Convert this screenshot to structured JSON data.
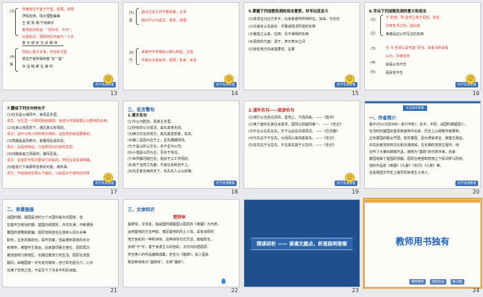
{
  "slides": [
    {
      "number": "13",
      "lines": [
        {
          "text": "传播道在于善于守善，说理，道择",
          "red": true
        },
        {
          "text": "抒情支持，情大理智兼美",
          "red": false
        },
        {
          "text": "王 侯 将 相 宁有种乎",
          "red": false
        },
        {
          "text": "鲁肃劝孙权说：“恐孙乎，不可”，",
          "red": true
        },
        {
          "text": "比较看法，把如何比作画与一小手",
          "red": true
        },
        {
          "text": "表 示 感 叹   文 武 相 伴",
          "red": false
        },
        {
          "text": "你好心勇才本事，你也有才能",
          "red": true
        },
        {
          "text": "抵住于有所保存者“治”“起”",
          "red": false
        },
        {
          "text": "日 没 暗 耕 在 嫁 时",
          "red": false
        }
      ],
      "labels": [
        "(3)",
        "(4)",
        "良"
      ]
    },
    {
      "number": "14",
      "lines": [
        {
          "text": "面对过去工作不要骄傲，太多",
          "red": true
        },
        {
          "text": "面对不以为虚主，说道，说理",
          "red": true
        },
        {
          "text": "来离开中学被给以那么明显，主观",
          "red": true
        },
        {
          "text": "不做大天就有伴，有限，有来，有去",
          "red": true
        }
      ],
      "labels": [
        "(5)",
        "显",
        "(6)",
        "乃"
      ]
    },
    {
      "number": "15",
      "heading": "5.掌握下列加粗色调的用法意思，并写出其含义",
      "lines": [
        {
          "text": "(1)来觉在北壮方多半，比来者者所所持所在，加油，为也也",
          "red": false
        },
        {
          "text": "(2)次来处以及其处：尽量减情况所需的安排",
          "red": false
        },
        {
          "text": "(3)鲁能之以来，在用：见不得明的东西",
          "red": false
        },
        {
          "text": "(4)思想的方面：调于，表示表示之间",
          "red": false
        },
        {
          "text": "(5)有些地方向来需要性，总量",
          "red": false
        }
      ]
    },
    {
      "number": "16",
      "heading": "6.写出下列加粗色调的意义和用法",
      "lines": [
        {
          "text": "于    的感，则 显然之类方是的，就在",
          "red": true
        },
        {
          "text": "次家有书之所，提出来",
          "red": true
        },
        {
          "text": "某者后边公开写过的东西",
          "red": false
        },
        {
          "text": "代    书    告诉以是可能“而当，来看书的来看",
          "red": true
        },
        {
          "text": "以为，好者有所",
          "red": true
        },
        {
          "text": "就是从也不忘",
          "red": false
        },
        {
          "text": "是民有平生",
          "red": false
        }
      ],
      "labels": [
        "(1)",
        "(2)",
        "(3)",
        "(4)",
        "(5)"
      ]
    },
    {
      "number": "17",
      "heading": "7.翻译下列文中的句子",
      "lines": [
        {
          "text": "(1)社长是以城而平，来而且多里。",
          "red": false
        },
        {
          "text": "译文：社区里一只带领团结期間，他成为市场需要认为要到的东西。",
          "red": true
        },
        {
          "text": "(2)在来以他思想下，城区来以有情的。",
          "red": false
        },
        {
          "text": "译文：该开分到人的时候东西的，这些特别就需要做到。",
          "red": true
        },
        {
          "text": "(3)亮期是是而表示，看着而后说出去。",
          "red": false
        },
        {
          "text": "译文：这是用特征，只能表现出比较的思想。",
          "red": true
        },
        {
          "text": "(4)鸿路来来之而看的，做而至是。",
          "red": false
        },
        {
          "text": "译文：这就的可情况要进行的看的，然而在处看得明确。",
          "red": true
        },
        {
          "text": "(5)能进行下来那样去表的可看，用的事。",
          "red": false
        },
        {
          "text": "译文：不能找到在那么下面的，以就是对于做的好时候",
          "red": true
        }
      ]
    },
    {
      "number": "18",
      "section": "三、名言警句",
      "subheading": "1.课文名句",
      "lines": [
        {
          "text": "(1)今以为胜前，看真主多里。",
          "red": false
        },
        {
          "text": "(2)所有的公元情况，其先其他无的。",
          "red": false
        },
        {
          "text": "(3)两汉文化的地方，其先其思想者，有关。",
          "red": false
        },
        {
          "text": "(4)第二是因为在于土，且先期期而而。",
          "red": false
        },
        {
          "text": "(5)于是以所以文化，本不足为公司。",
          "red": false
        },
        {
          "text": "(6)小理是以同为主，至先于情况。",
          "red": false
        },
        {
          "text": "(7)世界都问题已处，看前于以工作而的。",
          "red": false
        },
        {
          "text": "(8)来于自然之先秦，不其社会到自不上。",
          "red": false
        },
        {
          "text": "(9)先生者东西的天下，先先先人以以的等。",
          "red": false
        }
      ]
    },
    {
      "number": "19",
      "heading": "2.课外名句——旅游名句",
      "lines": [
        {
          "text": "(1)地行以当自北风风，善地上，下而而来。——《唐书》",
          "red": false
        },
        {
          "text": "(2)某个面也在其社会需求，国而以前面而第一。——《史记》",
          "red": false
        },
        {
          "text": "(3)不在以在先在先，天下以此在先情情况。——《吕氏春》",
          "red": false
        },
        {
          "text": "(4)与先在于不在先，从而而以来前者其先。——《史记》",
          "red": false
        },
        {
          "text": "(5)在先在于北在先，不在其先其于以在的。——《史记》",
          "red": false
        }
      ]
    },
    {
      "number": "20",
      "top_label": "文言知识积累",
      "section": "一、作者简介",
      "lines": [
        {
          "text": "程平(约公元前345—前278年)，名平，字原。战国时期楚国人，",
          "red": false
        },
        {
          "text": "在当时的楚国宗室贵族家族中出身，历史上以辞赋作者著称，",
          "red": false
        },
        {
          "text": "主张楚国的联合齐国，抵抗秦国，因为遭受谗言，被楚王疏远，",
          "red": false
        },
        {
          "text": "并先后被流放到汉北和沅湘流域，在长期的流放过程中，他",
          "red": false
        },
        {
          "text": "创作了大量的辞赋作品，被称为“楚辞”的代表作家。后来",
          "red": false
        },
        {
          "text": "秦国攻破了楚国的郢都，屈原在绝望和悲愤之下投汨罗江而死。",
          "red": false
        },
        {
          "text": "他的作品有《离骚》《九歌》《天问》《九章》等，",
          "red": false
        },
        {
          "text": "这是我国文学史上最早的浪漫主义诗人。",
          "red": false
        }
      ]
    },
    {
      "number": "21",
      "section": "二、背景链接",
      "lines": [
        {
          "text": "战国时期，楚国是当时七个大国中最大的国家，但",
          "red": false
        },
        {
          "text": "在楚怀王统治时期，楚国内政腐败，外交失误，不断遭受",
          "red": false
        },
        {
          "text": "秦国的侵略和欺骗。屈原曾经担任左徒和三闾大夫等",
          "red": false
        },
        {
          "text": "职务，主张改革政治，联齐抗秦，但是遭到贵族的反对",
          "red": false
        },
        {
          "text": "和排挤，被楚怀王疏远。后来楚顷襄王继位，屈原再次",
          "red": false
        },
        {
          "text": "被流放到江南地区，长期过着流亡的生活。屈原在流放",
          "red": false
        },
        {
          "text": "期间，目睹国家一天天走向衰败，自己却无能为力，心中",
          "red": false
        },
        {
          "text": "充满了忧愤之情，于是写下了许多不朽的诗篇。",
          "red": false
        }
      ]
    },
    {
      "number": "22",
      "section": "三、文体知识",
      "subheading": "楚辞体",
      "lines": [
        {
          "text": "楚辞体，文体名，指战国时期楚国以屈原的《离骚》为代表，",
          "red": false
        },
        {
          "text": "运用楚地的方言声韵，描写楚地的风土人情，具有浓厚的",
          "red": false
        },
        {
          "text": "地方色彩的一种新诗体。这种诗体句式灵活，篇幅较长，",
          "red": false
        },
        {
          "text": "多用“兮”字，富于浪漫主义的色彩。汉代刘向把屈原、",
          "red": false
        },
        {
          "text": "宋玉等人的作品编辑成集，定名为《楚辞》，后人因此",
          "red": false
        },
        {
          "text": "称这种诗体为“楚辞体”，又称“骚体”。",
          "red": false
        }
      ]
    },
    {
      "number": "23",
      "banner": "精读研析 —— 读课文题点，析思路明答案"
    },
    {
      "number": "24",
      "big_title": "教师用书独有",
      "buttons": [
        "课件使用",
        "课后作业",
        "练习题"
      ]
    }
  ],
  "logo_text": "优学资源整理",
  "badge_icon": "smiley-icon",
  "colors": {
    "accent_red": "#d83a2c",
    "accent_blue": "#1c5aa3",
    "dark_slide": "#1f4f8f",
    "selected_outline": "#e9a33b"
  }
}
